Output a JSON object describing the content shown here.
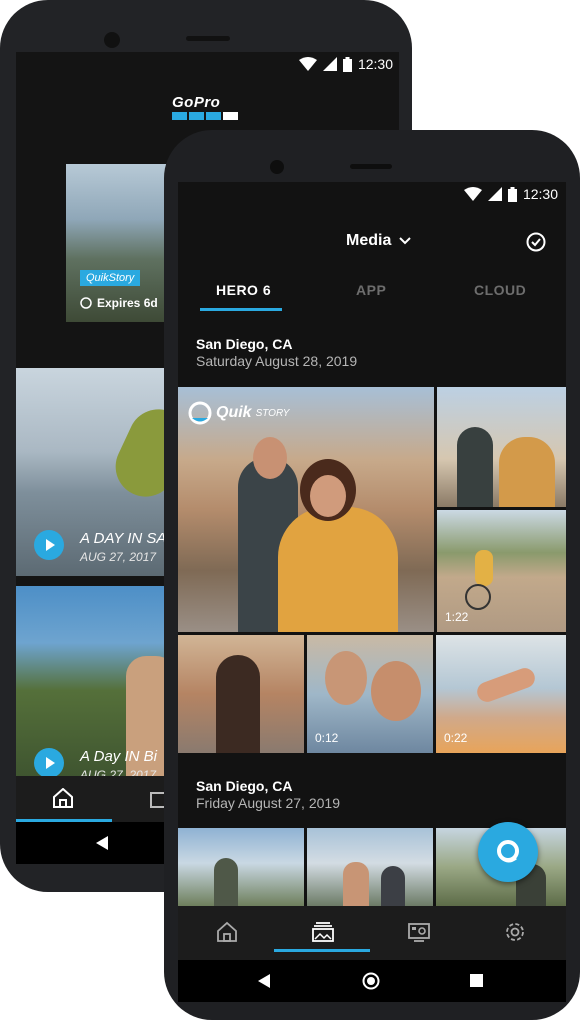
{
  "status_bar": {
    "time": "12:30"
  },
  "back_screen": {
    "logo_text": "GoPro",
    "story_card": {
      "badge": "QuikStory",
      "expires": "Expires 6d"
    },
    "videos": [
      {
        "title": "A DAY IN SA",
        "date": "AUG 27, 2017"
      },
      {
        "title": "A Day IN Bi",
        "date": "AUG 27, 2017"
      }
    ]
  },
  "front_screen": {
    "header": {
      "title": "Media"
    },
    "tabs": [
      {
        "label": "HERO 6",
        "active": true
      },
      {
        "label": "APP",
        "active": false
      },
      {
        "label": "CLOUD",
        "active": false
      }
    ],
    "sections": [
      {
        "location": "San Diego, CA",
        "date": "Saturday August 28, 2019"
      },
      {
        "location": "San Diego, CA",
        "date": "Friday August 27, 2019"
      }
    ],
    "quik_badge": {
      "brand": "Quik",
      "label": "STORY"
    },
    "durations": [
      "1:22",
      "0:12",
      "0:22"
    ]
  },
  "colors": {
    "accent": "#2aa9e0",
    "background": "#121212",
    "text_secondary": "#b5b5b5"
  }
}
